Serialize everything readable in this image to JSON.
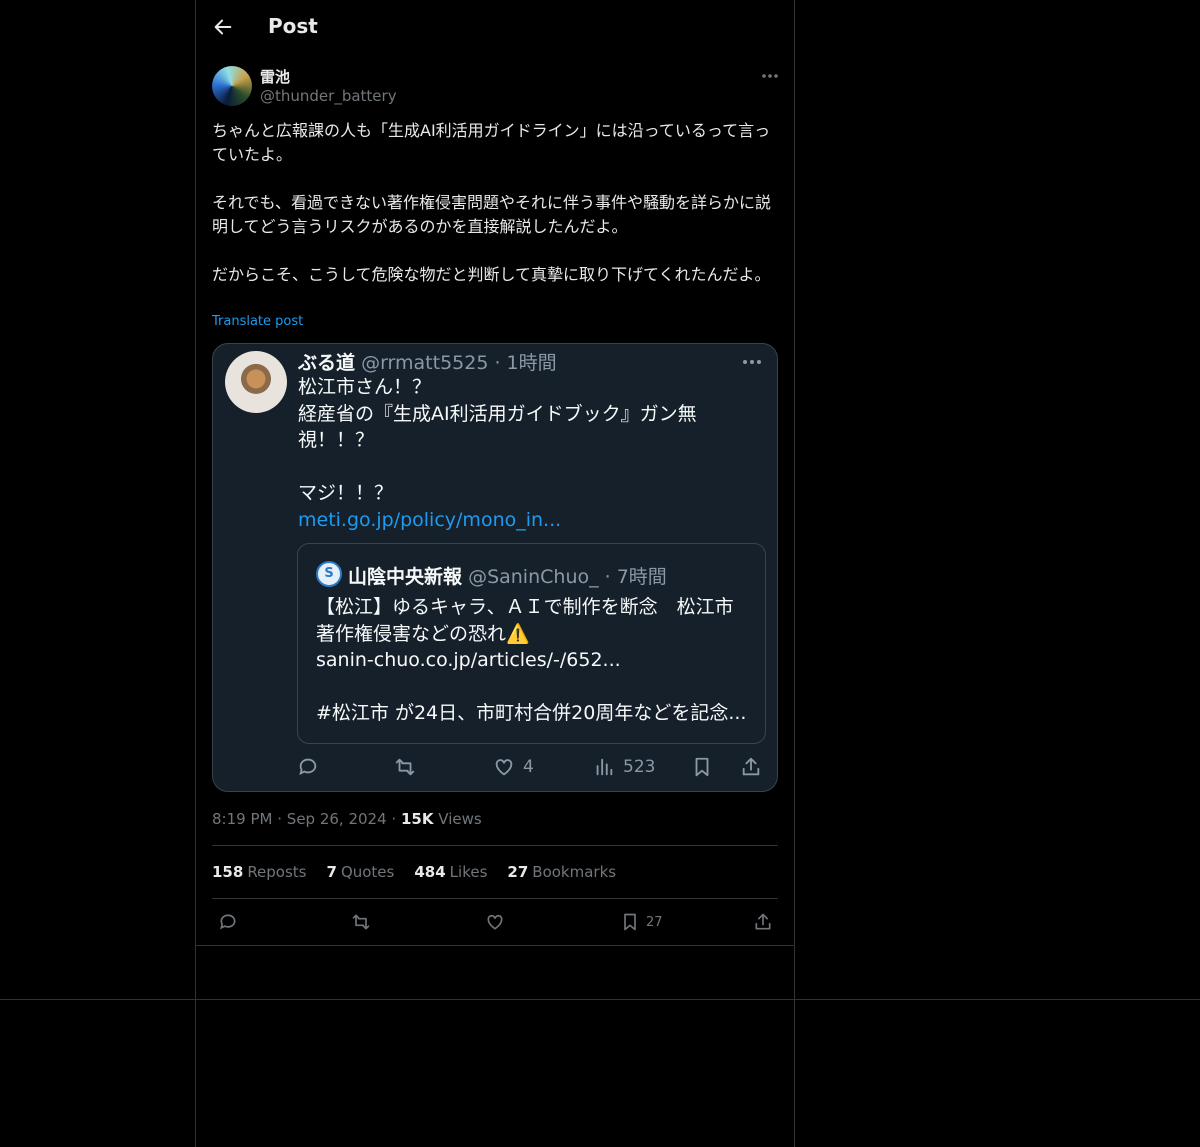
{
  "header": {
    "title": "Post"
  },
  "author": {
    "display_name": "雷池",
    "handle": "@thunder_battery"
  },
  "post": {
    "paragraphs": [
      "ちゃんと広報課の人も「生成AI利活用ガイドライン」には沿っているって言っていたよ。",
      "それでも、看過できない著作権侵害問題やそれに伴う事件や騒動を詳らかに説明してどう言うリスクがあるのかを直接解説したんだよ。",
      "だからこそ、こうして危険な物だと判断して真摯に取り下げてくれたんだよ。"
    ],
    "translate_label": "Translate post"
  },
  "quoted": {
    "name": "ぶる道",
    "handle_time": "@rrmatt5525 · 1時間",
    "lines": [
      "松江市さん！？",
      "経産省の『生成AI利活用ガイドブック』ガン無",
      "視！！？",
      "",
      "マジ！！？"
    ],
    "link": "meti.go.jp/policy/mono_in...",
    "nested": {
      "logo_text": "S",
      "name": "山陰中央新報",
      "handle_time": "@SaninChuo_ · 7時間",
      "lines": [
        "【松江】ゆるキャラ、ＡＩで制作を断念　松江市",
        "著作権侵害などの恐れ⚠️",
        "sanin-chuo.co.jp/articles/-/652...",
        "",
        "#松江市 が24日、市町村合併20周年などを記念..."
      ]
    },
    "like_count": "4",
    "view_count": "523"
  },
  "meta": {
    "time": "8:19 PM",
    "sep1": "·",
    "date": "Sep 26, 2024",
    "sep2": "·",
    "views_count": "15K",
    "views_label": "Views"
  },
  "stats": {
    "reposts_count": "158",
    "reposts_label": "Reposts",
    "quotes_count": "7",
    "quotes_label": "Quotes",
    "likes_count": "484",
    "likes_label": "Likes",
    "bookmarks_count": "27",
    "bookmarks_label": "Bookmarks"
  },
  "actions": {
    "bookmark_count": "27"
  },
  "colors": {
    "background": "#000000",
    "accent": "#1d9bf0",
    "text": "#e7e9ea",
    "muted": "#71767b",
    "border": "#2f3336"
  },
  "icons": [
    "back-arrow-icon",
    "more-icon",
    "reply-icon",
    "repost-icon",
    "like-icon",
    "views-icon",
    "bookmark-icon",
    "share-icon"
  ]
}
